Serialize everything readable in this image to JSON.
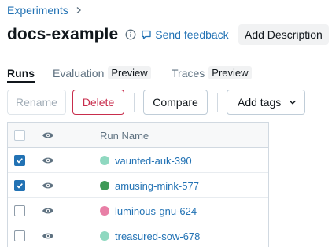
{
  "breadcrumb": {
    "experiments_label": "Experiments"
  },
  "header": {
    "title": "docs-example",
    "feedback_label": "Send feedback",
    "add_description_label": "Add Description"
  },
  "tabs": [
    {
      "label": "Runs",
      "active": true,
      "badge": ""
    },
    {
      "label": "Evaluation",
      "active": false,
      "badge": "Preview"
    },
    {
      "label": "Traces",
      "active": false,
      "badge": "Preview"
    }
  ],
  "toolbar": {
    "rename_label": "Rename",
    "delete_label": "Delete",
    "compare_label": "Compare",
    "add_tags_label": "Add tags"
  },
  "table": {
    "column_run_name": "Run Name",
    "rows": [
      {
        "name": "vaunted-auk-390",
        "color": "#8fd8c0",
        "checked": true
      },
      {
        "name": "amusing-mink-577",
        "color": "#3f9a57",
        "checked": true
      },
      {
        "name": "luminous-gnu-624",
        "color": "#e87fa6",
        "checked": false
      },
      {
        "name": "treasured-sow-678",
        "color": "#8fd8c0",
        "checked": false
      }
    ]
  },
  "colors": {
    "link": "#2272b4",
    "danger": "#c82d4c",
    "accent": "#2272b4"
  },
  "icons": [
    "chevron-right-icon",
    "info-icon",
    "feedback-icon",
    "chevron-down-icon",
    "eye-icon",
    "check-icon"
  ]
}
